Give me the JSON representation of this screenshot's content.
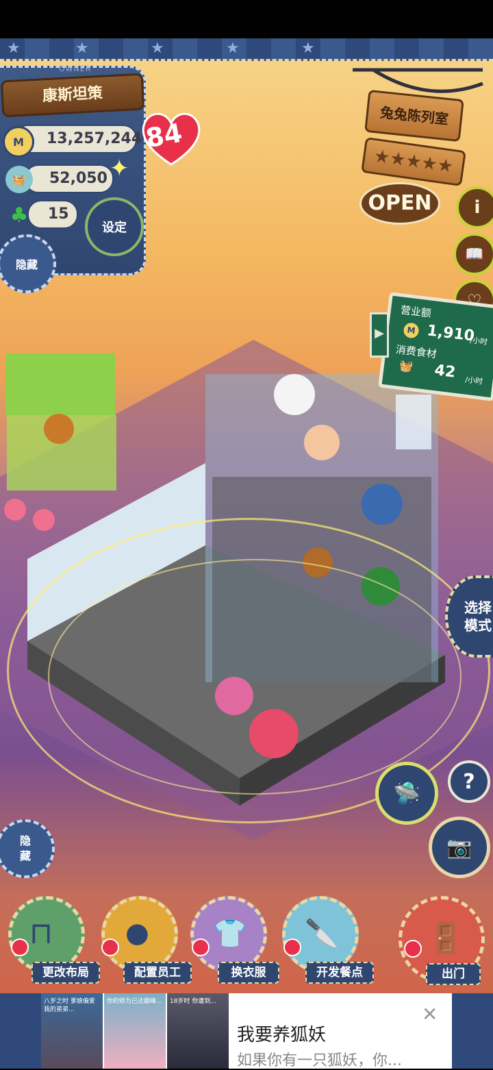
{
  "owner": {
    "tag": "OWNER",
    "name": "康斯坦策",
    "level": "84",
    "money": "13,257,244",
    "ingredients": "52,050",
    "clovers": "15"
  },
  "buttons": {
    "settings": "设定",
    "hide_top": "隐藏",
    "hide_bottom": "隐\n藏",
    "select_mode": "选择\n模式",
    "help": "?"
  },
  "shop": {
    "name": "兔兔陈列室",
    "status": "OPEN",
    "rating_stars": 5
  },
  "business": {
    "revenue_label": "营业额",
    "revenue_value": "1,910",
    "revenue_unit": "/小时",
    "food_label": "消费食材",
    "food_value": "42",
    "food_unit": "/小时"
  },
  "bottom_menu": [
    {
      "label": "更改布局",
      "color": "#5fa06a"
    },
    {
      "label": "配置员工",
      "color": "#e2a83a"
    },
    {
      "label": "换衣服",
      "color": "#a782c7"
    },
    {
      "label": "开发餐点",
      "color": "#7ec3d8"
    },
    {
      "label": "出门",
      "color": "#d85a4a"
    }
  ],
  "ad": {
    "title": "我要养狐妖",
    "description": "如果你有一只狐妖，你...",
    "thumbs": [
      {
        "text": "八岁之时 爹娘偏爱我的弟弟..."
      },
      {
        "text": "你的修为已达巅峰..."
      },
      {
        "text": "18岁时 你遭到..."
      }
    ]
  }
}
